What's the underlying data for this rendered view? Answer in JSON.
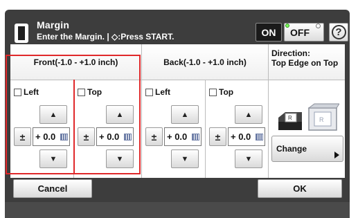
{
  "header": {
    "title": "Margin",
    "subtitle": "Enter the Margin. | ◇:Press START.",
    "on_label": "ON",
    "off_label": "OFF",
    "help_label": "?"
  },
  "columns": {
    "front": "Front(-1.0 - +1.0 inch)",
    "back": "Back(-1.0 - +1.0 inch)",
    "direction_label": "Direction:",
    "direction_value": "Top Edge on Top"
  },
  "fields": [
    {
      "label": "Left",
      "value": "+ 0.0"
    },
    {
      "label": "Top",
      "value": "+ 0.0"
    },
    {
      "label": "Left",
      "value": "+ 0.0"
    },
    {
      "label": "Top",
      "value": "+ 0.0"
    }
  ],
  "controls": {
    "up_glyph": "▲",
    "down_glyph": "▼",
    "sign_glyph": "±"
  },
  "direction": {
    "change_label": "Change"
  },
  "footer": {
    "cancel_label": "Cancel",
    "ok_label": "OK"
  },
  "colors": {
    "panel": "#3d3d3d",
    "highlight": "#e0282a"
  }
}
